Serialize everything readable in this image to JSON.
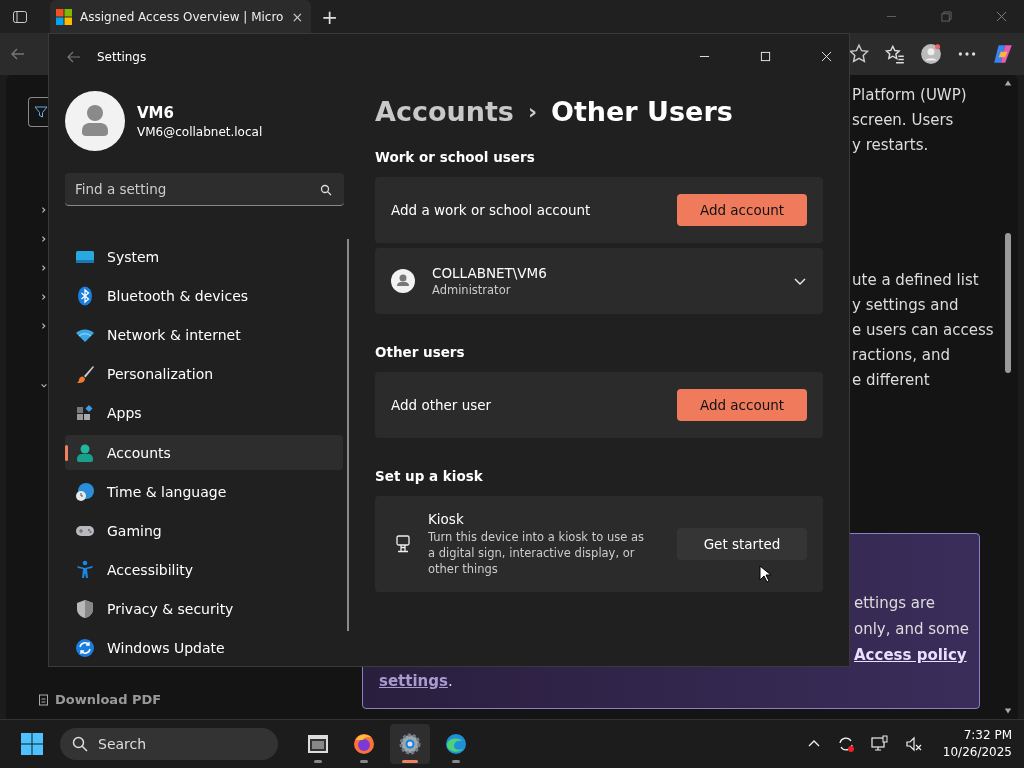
{
  "browser": {
    "tab_title": "Assigned Access Overview | Micro",
    "tab_close": "×",
    "new_tab": "+",
    "nav_tree": [
      {
        "expanded": false
      },
      {
        "expanded": false
      },
      {
        "expanded": false
      },
      {
        "expanded": false
      },
      {
        "expanded": false
      },
      {
        "expanded": true
      }
    ],
    "download": "Download PDF",
    "article": [
      [
        "Platform (UWP)",
        "screen. Users",
        "y restarts."
      ],
      [
        "ute a defined list",
        "y settings and",
        "e users can access",
        "ractions, and",
        "e different"
      ]
    ],
    "note": {
      "lines": [
        "ettings are",
        "only, and some"
      ],
      "link": "Access policy",
      "link2": "settings",
      "tail": "."
    }
  },
  "settings": {
    "title": "Settings",
    "user": {
      "name": "VM6",
      "email": "VM6@collabnet.local"
    },
    "search": {
      "placeholder": "Find a setting"
    },
    "nav": [
      {
        "label": "System",
        "selected": false
      },
      {
        "label": "Bluetooth & devices",
        "selected": false
      },
      {
        "label": "Network & internet",
        "selected": false
      },
      {
        "label": "Personalization",
        "selected": false
      },
      {
        "label": "Apps",
        "selected": false
      },
      {
        "label": "Accounts",
        "selected": true
      },
      {
        "label": "Time & language",
        "selected": false
      },
      {
        "label": "Gaming",
        "selected": false
      },
      {
        "label": "Accessibility",
        "selected": false
      },
      {
        "label": "Privacy & security",
        "selected": false
      },
      {
        "label": "Windows Update",
        "selected": false
      }
    ],
    "breadcrumb": {
      "parent": "Accounts",
      "separator": "›",
      "current": "Other Users"
    },
    "sections": [
      {
        "heading": "Work or school users",
        "cards": [
          {
            "kind": "action",
            "label": "Add a work or school account",
            "button": "Add account"
          },
          {
            "kind": "user",
            "name": "COLLABNET\\VM6",
            "role": "Administrator",
            "expanded": false
          }
        ]
      },
      {
        "heading": "Other users",
        "cards": [
          {
            "kind": "action",
            "label": "Add other user",
            "button": "Add account"
          }
        ]
      },
      {
        "heading": "Set up a kiosk",
        "cards": [
          {
            "kind": "kiosk",
            "label": "Kiosk",
            "description": "Turn this device into a kiosk to use as a digital sign, interactive display, or other things",
            "button": "Get started"
          }
        ]
      }
    ]
  },
  "taskbar": {
    "search": "Search",
    "apps": [
      {
        "active": false
      },
      {
        "active": false
      },
      {
        "active": true
      },
      {
        "active": false
      }
    ],
    "time": "7:32 PM",
    "date": "10/26/2025"
  }
}
